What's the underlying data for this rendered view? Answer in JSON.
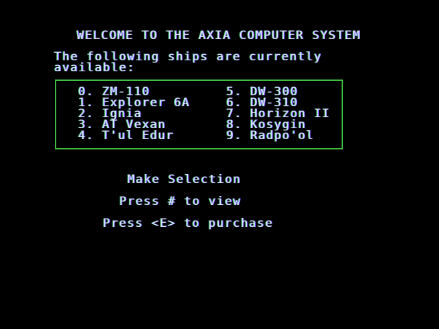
{
  "title": "WELCOME TO THE AXIA COMPUTER SYSTEM",
  "intro": {
    "line1": "The following ships are currently",
    "line2": "available:"
  },
  "ships": {
    "left": [
      "0. ZM-110",
      "1. Explorer 6A",
      "2. Ignia",
      "3. AT Vexan",
      "4. T'ul Edur"
    ],
    "right": [
      "5. DW-300",
      "6. DW-310",
      "7. Horizon II",
      "8. Kosygin",
      "9. Radpo'ol"
    ]
  },
  "menu": {
    "make_selection": "Make Selection",
    "press_view": "Press # to view",
    "press_purchase": "Press <E> to purchase"
  },
  "colors": {
    "background": "#000000",
    "text": "#d8e8ff",
    "border": "#3fbf3f"
  }
}
